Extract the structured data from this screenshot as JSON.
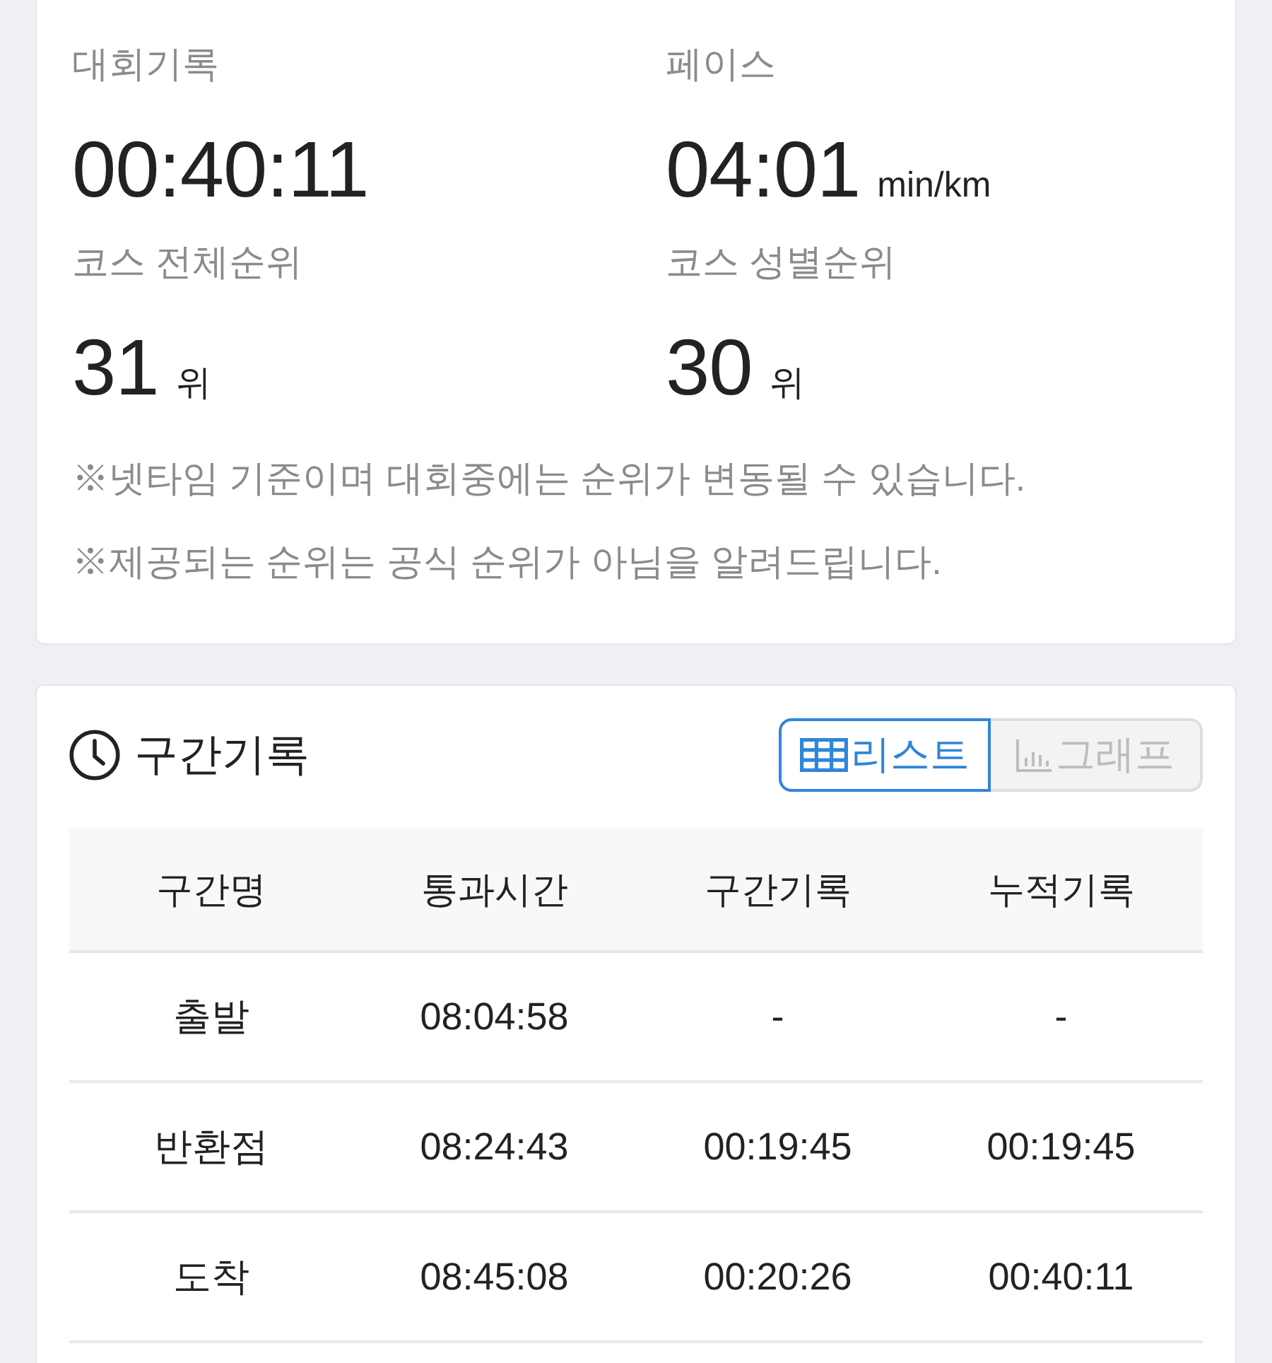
{
  "record_card": {
    "stats": [
      {
        "label": "대회기록",
        "value": "00:40:11"
      },
      {
        "label": "페이스",
        "value": "04:01",
        "unit": "min/km"
      },
      {
        "label": "코스 전체순위",
        "value": "31",
        "unit": "위"
      },
      {
        "label": "코스 성별순위",
        "value": "30",
        "unit": "위"
      }
    ],
    "notes": [
      "※넷타임 기준이며 대회중에는 순위가 변동될 수 있습니다.",
      "※제공되는 순위는 공식 순위가 아님을 알려드립니다."
    ]
  },
  "split_card": {
    "title": "구간기록",
    "view_toggle": [
      {
        "kind": "list",
        "label": "리스트",
        "selected": true
      },
      {
        "kind": "graph",
        "label": "그래프",
        "selected": false
      }
    ],
    "table": {
      "columns": [
        "구간명",
        "통과시간",
        "구간기록",
        "누적기록"
      ],
      "rows": [
        [
          "출발",
          "08:04:58",
          "-",
          "-"
        ],
        [
          "반환점",
          "08:24:43",
          "00:19:45",
          "00:19:45"
        ],
        [
          "도착",
          "08:45:08",
          "00:20:26",
          "00:40:11"
        ]
      ]
    }
  }
}
